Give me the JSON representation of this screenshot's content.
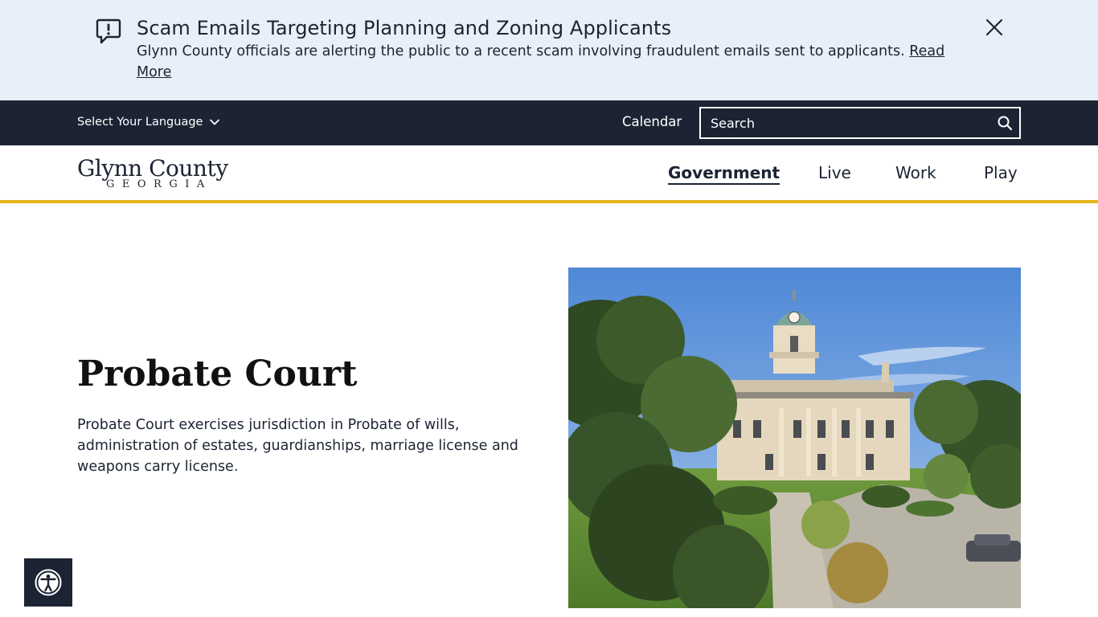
{
  "alert": {
    "title": "Scam Emails Targeting Planning and Zoning Applicants",
    "text": "Glynn County officials are alerting the public to a recent scam involving fraudulent emails sent to applicants. ",
    "link_text": "Read More ",
    "icon": "alert-message-icon",
    "close_icon": "close-icon"
  },
  "utility": {
    "language_label": "Select Your Language",
    "calendar_label": "Calendar",
    "search_placeholder": "Search",
    "search_icon": "search-icon"
  },
  "header": {
    "logo_main": "Glynn County",
    "logo_sub": "GEORGIA",
    "nav": [
      {
        "label": "Government",
        "active": true
      },
      {
        "label": "Live",
        "active": false
      },
      {
        "label": "Work",
        "active": false
      },
      {
        "label": "Play",
        "active": false
      }
    ],
    "accent_color": "#e4b61a"
  },
  "hero": {
    "title": "Probate Court",
    "description": "Probate Court exercises jurisdiction in Probate of wills, administration of estates, guardianships, marriage license and weapons carry license.",
    "image": "courthouse-photo"
  },
  "accessibility": {
    "icon": "accessibility-icon"
  },
  "colors": {
    "dark_navy": "#1c2434",
    "alert_bg": "#e8eff8",
    "accent_gold": "#e4b61a"
  }
}
